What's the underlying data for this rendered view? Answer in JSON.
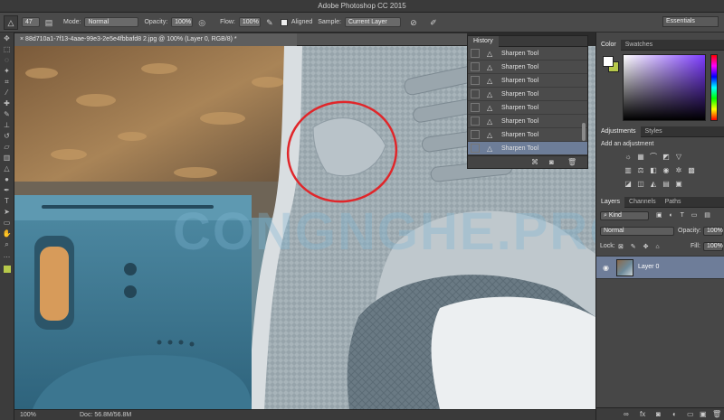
{
  "title_bar": {
    "title": "Adobe Photoshop CC 2015"
  },
  "options": {
    "brush_size": "47",
    "mode_label": "Mode:",
    "mode_value": "Normal",
    "opacity_label": "Opacity:",
    "opacity_value": "100%",
    "flow_label": "Flow:",
    "flow_value": "100%",
    "aligned_label": "Aligned",
    "sample_label": "Sample:",
    "sample_value": "Current Layer",
    "workspace": "Essentials"
  },
  "document": {
    "tab_label": "88d710a1-7f13-4aae-99e3-2e5e4fbbafd8 2.jpg @ 100% (Layer 0, RGB/8) *",
    "watermark": "CONGNGHE.PRO"
  },
  "status": {
    "zoom": "100%",
    "doc": "Doc: 56.8M/56.8M"
  },
  "history": {
    "title": "History",
    "items": [
      "Sharpen Tool",
      "Sharpen Tool",
      "Sharpen Tool",
      "Sharpen Tool",
      "Sharpen Tool",
      "Sharpen Tool",
      "Sharpen Tool",
      "Sharpen Tool"
    ],
    "selected_index": 7
  },
  "color_panel": {
    "tabs": [
      "Color",
      "Swatches"
    ],
    "foreground": "#ffffff",
    "background": "#b7c94a"
  },
  "adjustments_panel": {
    "tabs": [
      "Adjustments",
      "Styles"
    ],
    "heading": "Add an adjustment",
    "icons": [
      "brightness-icon",
      "levels-icon",
      "curves-icon",
      "exposure-icon",
      "vibrance-icon",
      "hue-saturation-icon",
      "color-balance-icon",
      "black-white-icon",
      "photo-filter-icon",
      "channel-mixer-icon",
      "color-lookup-icon",
      "invert-icon",
      "posterize-icon",
      "threshold-icon",
      "gradient-map-icon",
      "selective-color-icon"
    ]
  },
  "layers_panel": {
    "tabs": [
      "Layers",
      "Channels",
      "Paths"
    ],
    "filter_label": "Kind",
    "blend_mode": "Normal",
    "opacity_label": "Opacity:",
    "opacity_value": "100%",
    "lock_label": "Lock:",
    "fill_label": "Fill:",
    "fill_value": "100%",
    "layers": [
      {
        "name": "Layer 0"
      }
    ]
  },
  "colors": {
    "annotation_circle": "#e0262a",
    "selection_highlight": "#6d7d98"
  }
}
